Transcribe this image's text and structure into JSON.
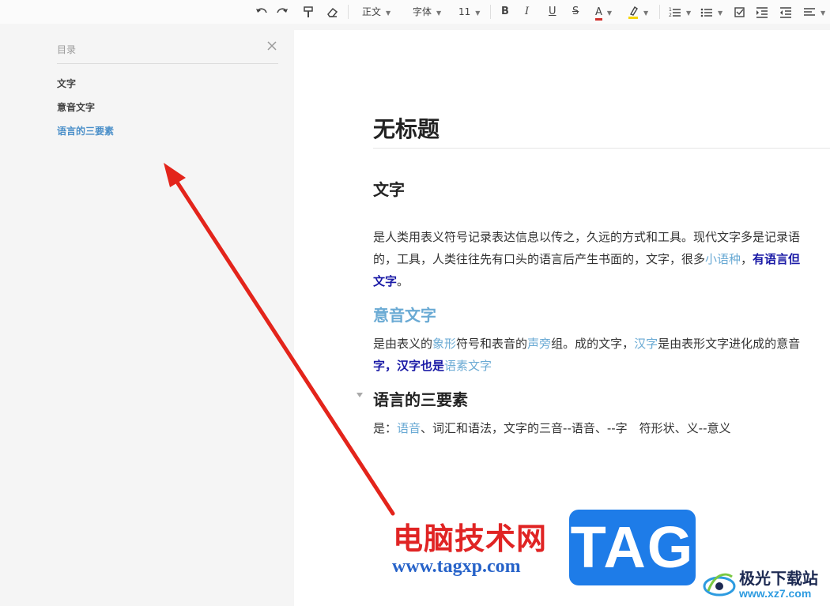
{
  "toolbar": {
    "style_select": "正文",
    "font_select": "字体",
    "size_select": "11",
    "bold": "B",
    "italic": "I",
    "underline": "U",
    "strike": "S",
    "font_color": "A",
    "colors": {
      "font_color_bar": "#d0312d",
      "highlight_bar": "#f5d400"
    }
  },
  "toc": {
    "title": "目录",
    "items": [
      "文字",
      "意音文字",
      "语言的三要素"
    ],
    "active_index": 2
  },
  "doc": {
    "title": "无标题",
    "sections": [
      {
        "heading": "文字",
        "lines": [
          [
            "是人类用表义符号记录表达信息以传之，久远的方式和工具。现代文字多是记录语"
          ],
          [
            "的，工具，人类往往先有口头的语言后产生书面的，文字，很多",
            "小语种",
            "，",
            "有语言但"
          ],
          [
            "文字",
            "。"
          ]
        ]
      },
      {
        "heading": "意音文字",
        "lines": [
          [
            "是由表义的",
            "象形",
            "符号和表音的",
            "声旁",
            "组。成的文字，",
            "汉字",
            "是由表形文字进化成的意音"
          ],
          [
            "字，汉字也是",
            "语素文字"
          ]
        ]
      },
      {
        "heading": "语言的三要素",
        "lines": [
          [
            "是：",
            "语音",
            "、词汇和语法，文字的三音--语音、--字　符形状、义--意义"
          ]
        ]
      }
    ]
  },
  "watermark": {
    "brand_cn": "电脑技术网",
    "brand_url": "www.tagxp.com",
    "tag": "TAG",
    "site_cn": "极光下载站",
    "site_url": "www.xz7.com"
  },
  "colors": {
    "link": "#6aaad4",
    "emphasis": "#1a1aa6",
    "active_toc": "#4a8fc9",
    "arrow": "#e3241b",
    "tag_bg": "#1e7ce8"
  }
}
